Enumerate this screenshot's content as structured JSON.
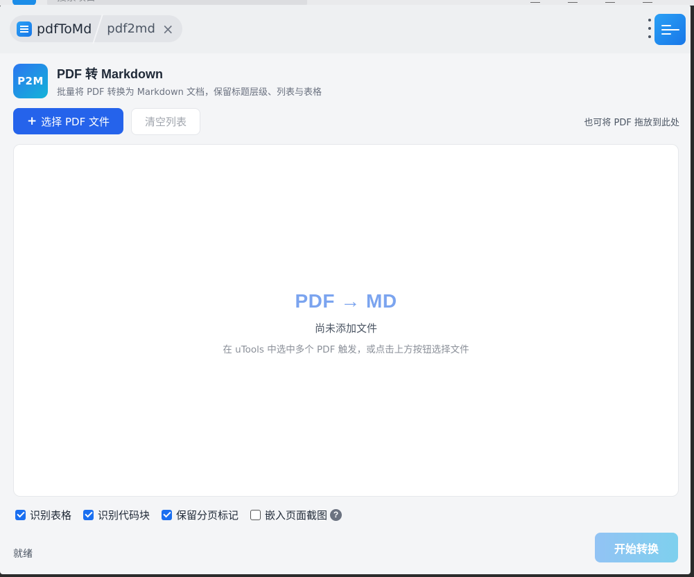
{
  "os": {
    "search_placeholder": "搜索项目"
  },
  "tabs": {
    "main_label": "pdfToMd",
    "sub_label": "pdf2md",
    "close_glyph": "×"
  },
  "header": {
    "logo_text": "P2M",
    "title": "PDF 转 Markdown",
    "subtitle": "批量将 PDF 转换为 Markdown 文档，保留标题层级、列表与表格"
  },
  "toolbar": {
    "select_plus": "+",
    "select_label": "选择 PDF 文件",
    "clear_label": "清空列表",
    "drop_hint": "也可将 PDF 拖放到此处"
  },
  "dropzone": {
    "big_text": "PDF → MD",
    "empty_text": "尚未添加文件",
    "hint_text": "在 uTools 中选中多个 PDF 触发，或点击上方按钮选择文件"
  },
  "options": [
    {
      "label": "识别表格",
      "checked": true
    },
    {
      "label": "识别代码块",
      "checked": true
    },
    {
      "label": "保留分页标记",
      "checked": true
    },
    {
      "label": "嵌入页面截图",
      "checked": false
    }
  ],
  "help_glyph": "?",
  "status": "就绪",
  "convert_label": "开始转换",
  "colors": {
    "primary": "#2563eb",
    "checkbox": "#1a6ff0",
    "accent_text": "#7ba4ef",
    "convert_gradient_start": "#92c3f4",
    "convert_gradient_end": "#7ed0ee"
  }
}
